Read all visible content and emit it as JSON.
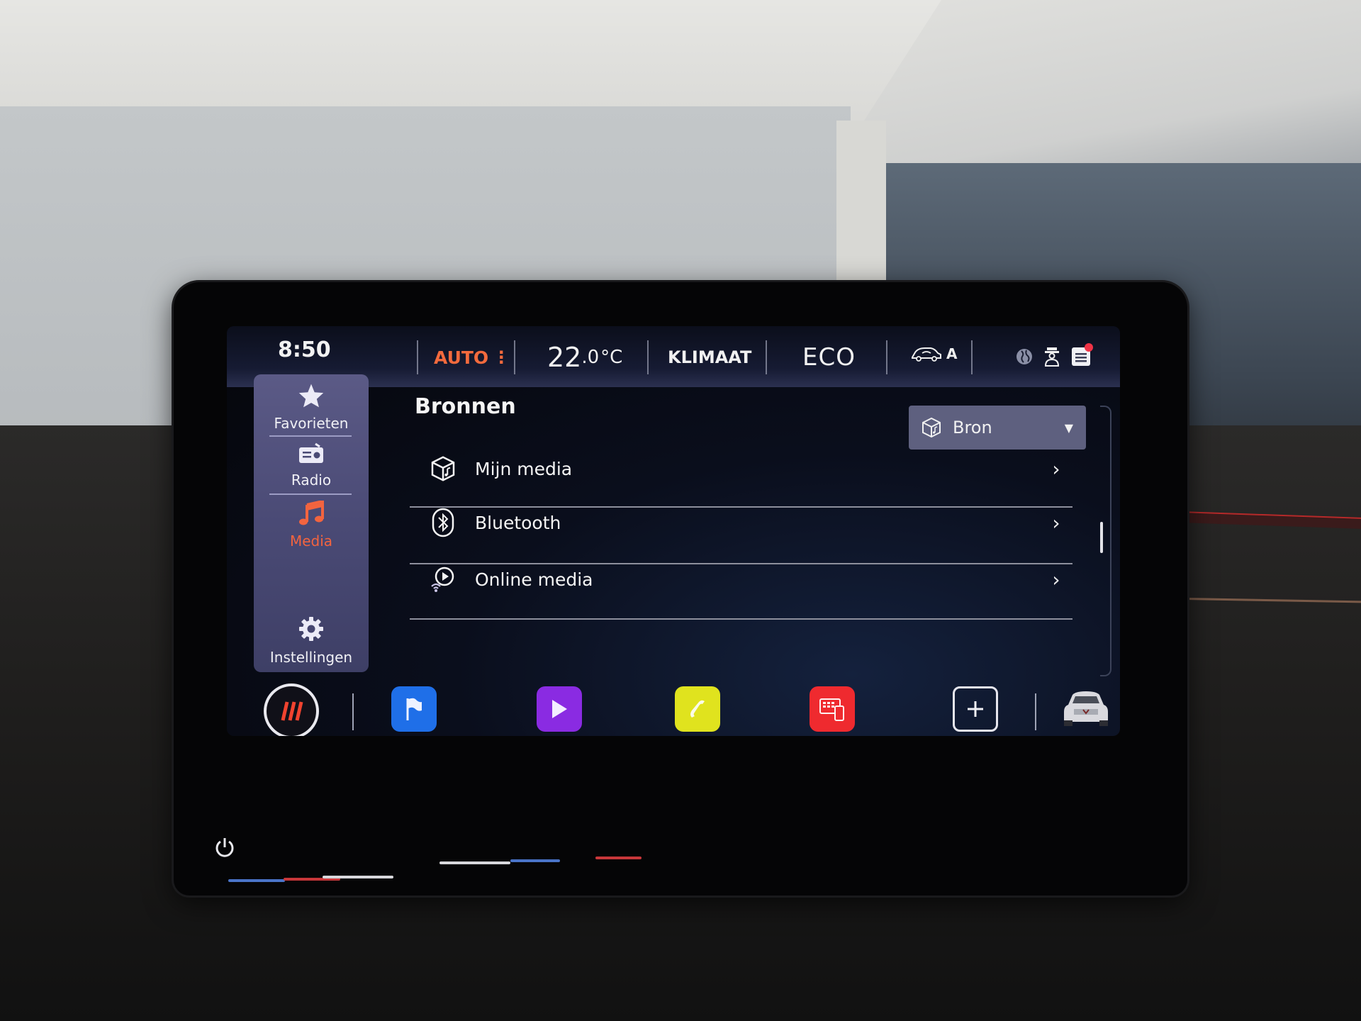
{
  "status_bar": {
    "time": "8:50",
    "climate_mode": "AUTO",
    "climate_mode_menu_icon": "vertical-dots-icon",
    "temperature_value": "22",
    "temperature_decimal": ".0",
    "temperature_unit": "°C",
    "climate_label": "KLIMAAT",
    "drive_mode": "ECO",
    "air_recirculation_label": "A",
    "air_recirculation_icon": "car-air-recirculation-icon",
    "globe_icon": "globe-icon",
    "profile_icon": "user-profile-icon",
    "notifications_icon": "notifications-icon",
    "notification_badge_color": "#f03346"
  },
  "sidebar": {
    "items": [
      {
        "label": "Favorieten",
        "icon": "star-icon",
        "active": false
      },
      {
        "label": "Radio",
        "icon": "radio-icon",
        "active": false
      },
      {
        "label": "Media",
        "icon": "music-note-icon",
        "active": true
      },
      {
        "label": "Instellingen",
        "icon": "gear-icon",
        "active": false
      }
    ],
    "active_color": "#f3643f"
  },
  "main": {
    "title": "Bronnen",
    "source_dropdown": {
      "label": "Bron",
      "icon": "media-box-icon"
    },
    "sources": [
      {
        "label": "Mijn media",
        "icon": "media-box-icon"
      },
      {
        "label": "Bluetooth",
        "icon": "bluetooth-icon"
      },
      {
        "label": "Online media",
        "icon": "online-media-icon"
      }
    ]
  },
  "dock": {
    "home_icon": "brand-stripes-icon",
    "apps": [
      {
        "name": "navigation",
        "icon": "flag-icon",
        "color": "#1f6fe8"
      },
      {
        "name": "media",
        "icon": "play-icon",
        "color": "#8a2be2"
      },
      {
        "name": "phone",
        "icon": "phone-icon",
        "color": "#e0e31e"
      },
      {
        "name": "app-connect",
        "icon": "app-connect-icon",
        "color": "#ef2a2f"
      }
    ],
    "add_icon": "plus-icon",
    "vehicle_icon": "car-icon"
  },
  "console": {
    "power_icon": "power-icon"
  }
}
